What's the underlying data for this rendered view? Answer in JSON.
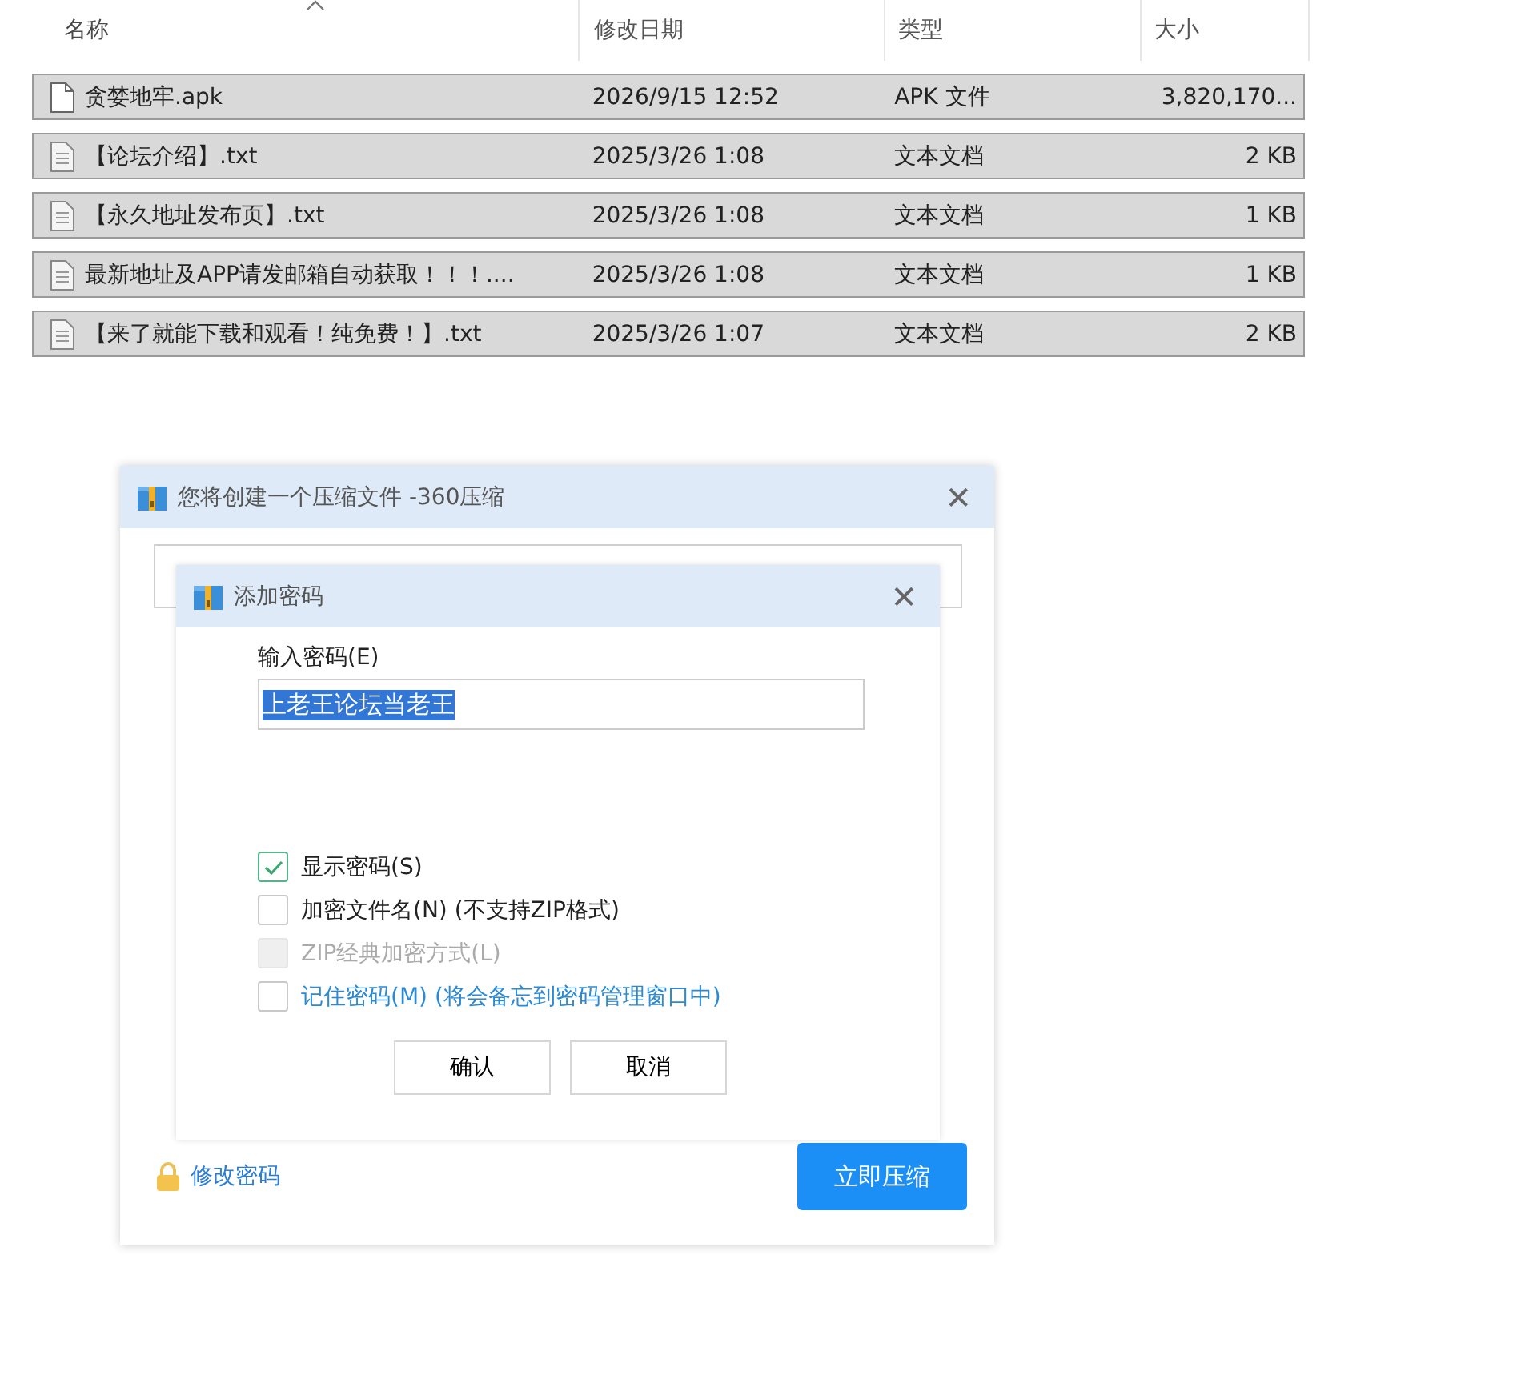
{
  "file_list": {
    "columns": [
      {
        "label": "名称",
        "sorted": true
      },
      {
        "label": "修改日期",
        "sorted": false
      },
      {
        "label": "类型",
        "sorted": false
      },
      {
        "label": "大小",
        "sorted": false
      }
    ],
    "rows": [
      {
        "kind": "apk",
        "name": "贪婪地牢.apk",
        "modified": "2026/9/15 12:52",
        "type": "APK 文件",
        "size": "3,820,170...",
        "selected": true
      },
      {
        "kind": "txt",
        "name": "【论坛介绍】.txt",
        "modified": "2025/3/26 1:08",
        "type": "文本文档",
        "size": "2 KB",
        "selected": true
      },
      {
        "kind": "txt",
        "name": "【永久地址发布页】.txt",
        "modified": "2025/3/26 1:08",
        "type": "文本文档",
        "size": "1 KB",
        "selected": true
      },
      {
        "kind": "txt",
        "name": "最新地址及APP请发邮箱自动获取！！！....",
        "modified": "2025/3/26 1:08",
        "type": "文本文档",
        "size": "1 KB",
        "selected": true
      },
      {
        "kind": "txt",
        "name": "【来了就能下载和观看！纯免费！】.txt",
        "modified": "2025/3/26 1:07",
        "type": "文本文档",
        "size": "2 KB",
        "selected": true
      }
    ]
  },
  "compress_dialog": {
    "title": "您将创建一个压缩文件 -360压缩",
    "close": "✕",
    "change_password_link": "修改密码",
    "primary_button": "立即压缩"
  },
  "password_dialog": {
    "title": "添加密码",
    "close": "✕",
    "password_label": "输入密码(E)",
    "password_value": "上老王论坛当老王",
    "value_selected": true,
    "options": [
      {
        "kind": "plain",
        "label": "显示密码(S)",
        "checked": true,
        "disabled": false
      },
      {
        "kind": "plain",
        "label": "加密文件名(N) (不支持ZIP格式)",
        "checked": false,
        "disabled": false
      },
      {
        "kind": "plain",
        "label": "ZIP经典加密方式(L)",
        "checked": false,
        "disabled": true
      },
      {
        "kind": "link",
        "label": "记住密码(M) (将会备忘到密码管理窗口中)",
        "checked": false,
        "disabled": false
      }
    ],
    "buttons": [
      "确认",
      "取消"
    ]
  }
}
